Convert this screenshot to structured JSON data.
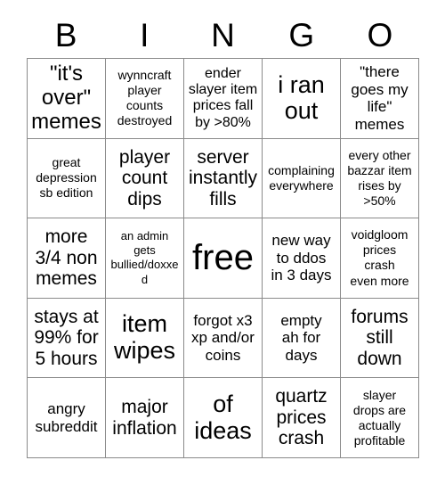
{
  "card": {
    "title": "BINGO",
    "header_letters": [
      "B",
      "I",
      "N",
      "G",
      "O"
    ],
    "grid_size": 5,
    "colors": {
      "background": "#ffffff",
      "text": "#000000",
      "border": "#8a8a8a"
    },
    "rows": [
      [
        {
          "text": "\"it's\nover\"\nmemes",
          "size": "lg"
        },
        {
          "text": "wynncraft\nplayer\ncounts\ndestroyed",
          "size": "xs"
        },
        {
          "text": "ender\nslayer item\nprices fall\nby >80%",
          "size": "sm"
        },
        {
          "text": "i ran\nout",
          "size": "xl"
        },
        {
          "text": "\"there\ngoes my\nlife\"\nmemes",
          "size": "sm"
        }
      ],
      [
        {
          "text": "great\ndepression\nsb edition",
          "size": "xs"
        },
        {
          "text": "player\ncount\ndips",
          "size": "md"
        },
        {
          "text": "server\ninstantly\nfills",
          "size": "md"
        },
        {
          "text": "complaining\neverywhere",
          "size": "xs"
        },
        {
          "text": "every other\nbazzar item\nrises by\n>50%",
          "size": "xs"
        }
      ],
      [
        {
          "text": "more\n3/4 non\nmemes",
          "size": "md"
        },
        {
          "text": "an admin gets\nbullied/doxxed",
          "size": "xxs"
        },
        {
          "text": "free",
          "size": "xxl"
        },
        {
          "text": "new way\nto ddos\nin 3 days",
          "size": "sm"
        },
        {
          "text": "voidgloom\nprices\ncrash\neven more",
          "size": "xs"
        }
      ],
      [
        {
          "text": "stays at\n99% for\n5 hours",
          "size": "md"
        },
        {
          "text": "item\nwipes",
          "size": "xl"
        },
        {
          "text": "forgot x3\nxp and/or\ncoins",
          "size": "sm"
        },
        {
          "text": "empty\nah for\ndays",
          "size": "sm"
        },
        {
          "text": "forums\nstill\ndown",
          "size": "md"
        }
      ],
      [
        {
          "text": "angry\nsubreddit",
          "size": "sm"
        },
        {
          "text": "major\ninflation",
          "size": "md"
        },
        {
          "text": "of\nideas",
          "size": "xl"
        },
        {
          "text": "quartz\nprices\ncrash",
          "size": "md"
        },
        {
          "text": "slayer\ndrops are\nactually\nprofitable",
          "size": "xs"
        }
      ]
    ]
  }
}
